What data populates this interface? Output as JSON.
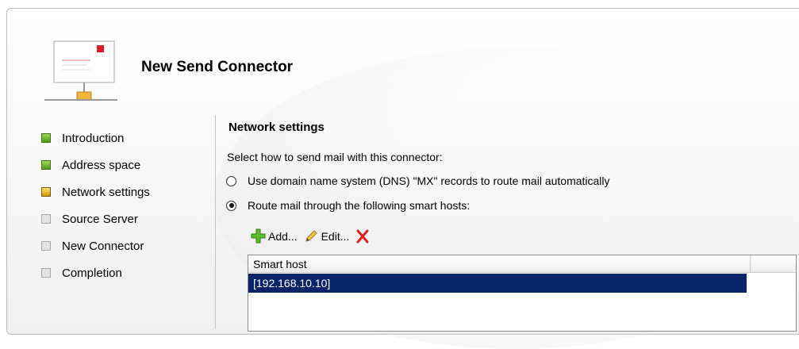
{
  "wizard": {
    "title": "New Send Connector",
    "header_icon": "send-connector-network-icon"
  },
  "nav": {
    "items": [
      {
        "label": "Introduction",
        "state": "done"
      },
      {
        "label": "Address space",
        "state": "done"
      },
      {
        "label": "Network settings",
        "state": "current"
      },
      {
        "label": "Source Server",
        "state": "pending"
      },
      {
        "label": "New Connector",
        "state": "pending"
      },
      {
        "label": "Completion",
        "state": "pending"
      }
    ]
  },
  "page": {
    "section_title": "Network settings",
    "instructions": "Select how to send mail with this connector:",
    "options": [
      {
        "label": "Use domain name system (DNS) \"MX\" records to route mail automatically",
        "selected": false
      },
      {
        "label": "Route mail through the following smart hosts:",
        "selected": true
      }
    ]
  },
  "toolbar": {
    "add_label": "Add...",
    "edit_label": "Edit...",
    "remove_icon": "red-x-icon"
  },
  "smart_hosts": {
    "column_header": "Smart host",
    "rows": [
      "[192.168.10.10]"
    ]
  },
  "colors": {
    "done": "#4f9a1a",
    "current": "#d19a00",
    "selection": "#0a246a"
  }
}
